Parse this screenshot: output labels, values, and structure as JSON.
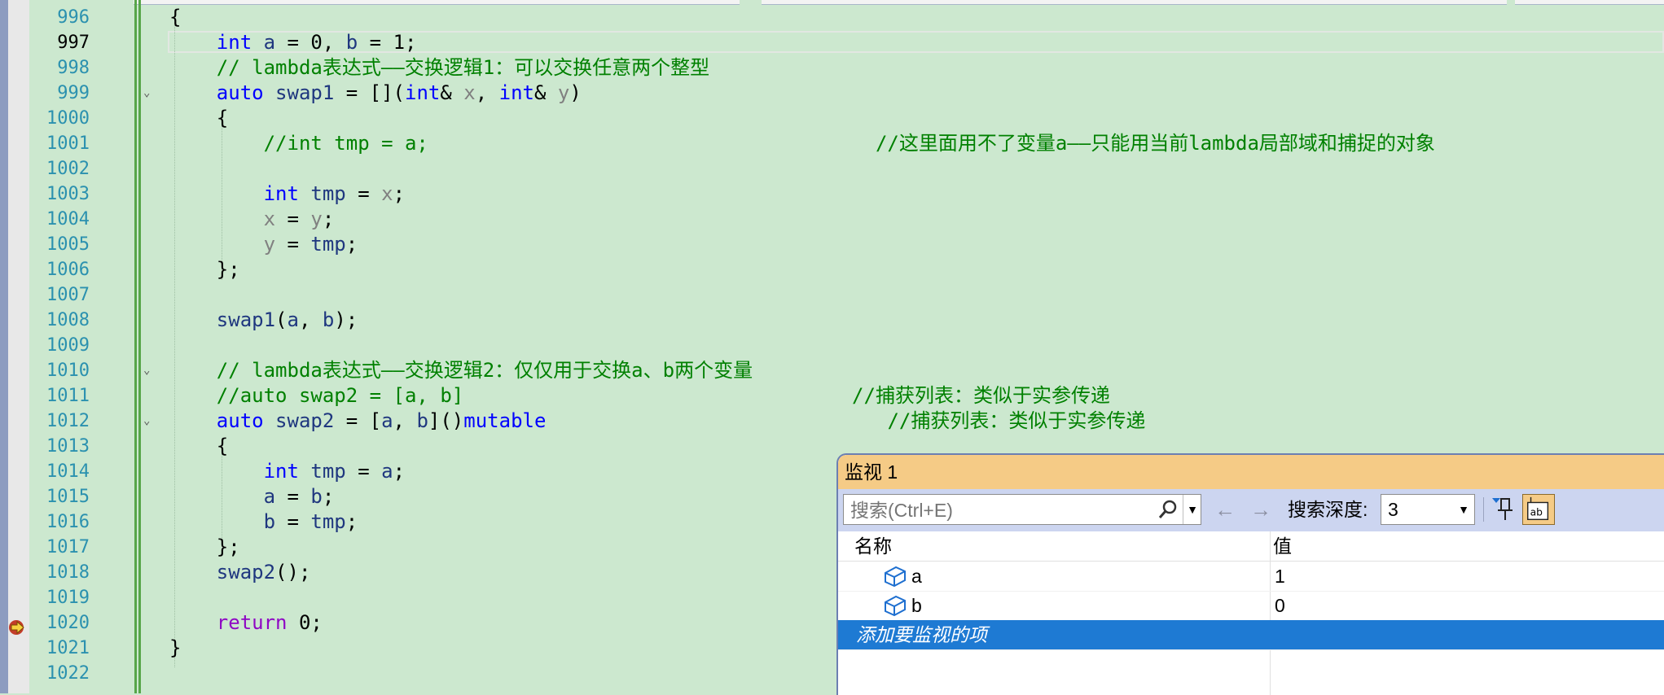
{
  "editor": {
    "lines": [
      {
        "num": "996",
        "tokens": [
          {
            "t": "{",
            "c": ""
          }
        ]
      },
      {
        "num": "997",
        "tokens": [
          {
            "t": "    ",
            "c": ""
          },
          {
            "t": "int",
            "c": "kw"
          },
          {
            "t": " ",
            "c": ""
          },
          {
            "t": "a",
            "c": "id"
          },
          {
            "t": " = 0, ",
            "c": ""
          },
          {
            "t": "b",
            "c": "id"
          },
          {
            "t": " = 1;",
            "c": ""
          }
        ]
      },
      {
        "num": "998",
        "tokens": [
          {
            "t": "    // lambda表达式——交换逻辑1：可以交换任意两个整型",
            "c": "cm"
          }
        ]
      },
      {
        "num": "999",
        "tokens": [
          {
            "t": "    ",
            "c": ""
          },
          {
            "t": "auto",
            "c": "kw"
          },
          {
            "t": " ",
            "c": ""
          },
          {
            "t": "swap1",
            "c": "id"
          },
          {
            "t": " = [](",
            "c": ""
          },
          {
            "t": "int",
            "c": "kw"
          },
          {
            "t": "& ",
            "c": ""
          },
          {
            "t": "x",
            "c": "gv"
          },
          {
            "t": ", ",
            "c": ""
          },
          {
            "t": "int",
            "c": "kw"
          },
          {
            "t": "& ",
            "c": ""
          },
          {
            "t": "y",
            "c": "gv"
          },
          {
            "t": ")",
            "c": ""
          }
        ]
      },
      {
        "num": "1000",
        "tokens": [
          {
            "t": "    {",
            "c": ""
          }
        ]
      },
      {
        "num": "1001",
        "tokens": [
          {
            "t": "        //int tmp = a;                                      //这里面用不了变量a——只能用当前lambda局部域和捕捉的对象",
            "c": "cm"
          }
        ]
      },
      {
        "num": "1002",
        "tokens": []
      },
      {
        "num": "1003",
        "tokens": [
          {
            "t": "        ",
            "c": ""
          },
          {
            "t": "int",
            "c": "kw"
          },
          {
            "t": " ",
            "c": ""
          },
          {
            "t": "tmp",
            "c": "id"
          },
          {
            "t": " = ",
            "c": ""
          },
          {
            "t": "x",
            "c": "gv"
          },
          {
            "t": ";",
            "c": ""
          }
        ]
      },
      {
        "num": "1004",
        "tokens": [
          {
            "t": "        ",
            "c": ""
          },
          {
            "t": "x",
            "c": "gv"
          },
          {
            "t": " = ",
            "c": ""
          },
          {
            "t": "y",
            "c": "gv"
          },
          {
            "t": ";",
            "c": ""
          }
        ]
      },
      {
        "num": "1005",
        "tokens": [
          {
            "t": "        ",
            "c": ""
          },
          {
            "t": "y",
            "c": "gv"
          },
          {
            "t": " = ",
            "c": ""
          },
          {
            "t": "tmp",
            "c": "id"
          },
          {
            "t": ";",
            "c": ""
          }
        ]
      },
      {
        "num": "1006",
        "tokens": [
          {
            "t": "    };",
            "c": ""
          }
        ]
      },
      {
        "num": "1007",
        "tokens": []
      },
      {
        "num": "1008",
        "tokens": [
          {
            "t": "    ",
            "c": ""
          },
          {
            "t": "swap1",
            "c": "id"
          },
          {
            "t": "(",
            "c": ""
          },
          {
            "t": "a",
            "c": "id"
          },
          {
            "t": ", ",
            "c": ""
          },
          {
            "t": "b",
            "c": "id"
          },
          {
            "t": ");",
            "c": ""
          }
        ]
      },
      {
        "num": "1009",
        "tokens": []
      },
      {
        "num": "1010",
        "tokens": [
          {
            "t": "    // lambda表达式——交换逻辑2：仅仅用于交换a、b两个变量",
            "c": "cm"
          }
        ]
      },
      {
        "num": "1011",
        "tokens": [
          {
            "t": "    //auto swap2 = [a, b]                                 //捕获列表：类似于实参传递",
            "c": "cm"
          }
        ]
      },
      {
        "num": "1012",
        "tokens": [
          {
            "t": "    ",
            "c": ""
          },
          {
            "t": "auto",
            "c": "kw"
          },
          {
            "t": " ",
            "c": ""
          },
          {
            "t": "swap2",
            "c": "id"
          },
          {
            "t": " = [",
            "c": ""
          },
          {
            "t": "a",
            "c": "id"
          },
          {
            "t": ", ",
            "c": ""
          },
          {
            "t": "b",
            "c": "id"
          },
          {
            "t": "]()",
            "c": ""
          },
          {
            "t": "mutable",
            "c": "kw"
          },
          {
            "t": "                             ",
            "c": ""
          },
          {
            "t": "//捕获列表：类似于实参传递",
            "c": "cm"
          }
        ]
      },
      {
        "num": "1013",
        "tokens": [
          {
            "t": "    {",
            "c": ""
          }
        ]
      },
      {
        "num": "1014",
        "tokens": [
          {
            "t": "        ",
            "c": ""
          },
          {
            "t": "int",
            "c": "kw"
          },
          {
            "t": " ",
            "c": ""
          },
          {
            "t": "tmp",
            "c": "id"
          },
          {
            "t": " = ",
            "c": ""
          },
          {
            "t": "a",
            "c": "id"
          },
          {
            "t": ";",
            "c": ""
          }
        ]
      },
      {
        "num": "1015",
        "tokens": [
          {
            "t": "        ",
            "c": ""
          },
          {
            "t": "a",
            "c": "id"
          },
          {
            "t": " = ",
            "c": ""
          },
          {
            "t": "b",
            "c": "id"
          },
          {
            "t": ";",
            "c": ""
          }
        ]
      },
      {
        "num": "1016",
        "tokens": [
          {
            "t": "        ",
            "c": ""
          },
          {
            "t": "b",
            "c": "id"
          },
          {
            "t": " = ",
            "c": ""
          },
          {
            "t": "tmp",
            "c": "id"
          },
          {
            "t": ";",
            "c": ""
          }
        ]
      },
      {
        "num": "1017",
        "tokens": [
          {
            "t": "    };",
            "c": ""
          }
        ]
      },
      {
        "num": "1018",
        "tokens": [
          {
            "t": "    ",
            "c": ""
          },
          {
            "t": "swap2",
            "c": "id"
          },
          {
            "t": "();",
            "c": ""
          }
        ]
      },
      {
        "num": "1019",
        "tokens": []
      },
      {
        "num": "1020",
        "tokens": [
          {
            "t": "    ",
            "c": ""
          },
          {
            "t": "return",
            "c": "kw2"
          },
          {
            "t": " 0;",
            "c": ""
          }
        ]
      },
      {
        "num": "1021",
        "tokens": [
          {
            "t": "}",
            "c": ""
          }
        ]
      },
      {
        "num": "1022",
        "tokens": []
      }
    ],
    "current_line": "997",
    "breakpoint_line": "1020"
  },
  "watch": {
    "title": "监视 1",
    "search_placeholder": "搜索(Ctrl+E)",
    "depth_label": "搜索深度:",
    "depth_value": "3",
    "col_name": "名称",
    "col_value": "值",
    "rows": [
      {
        "name": "a",
        "value": "1"
      },
      {
        "name": "b",
        "value": "0"
      }
    ],
    "add_item_label": "添加要监视的项"
  },
  "colors": {
    "background": "#cce8cf",
    "keyword": "#0000ff",
    "comment": "#008000",
    "line_number": "#2b91af",
    "watch_title_bg": "#f5cb86",
    "selection": "#1e7ad3"
  }
}
